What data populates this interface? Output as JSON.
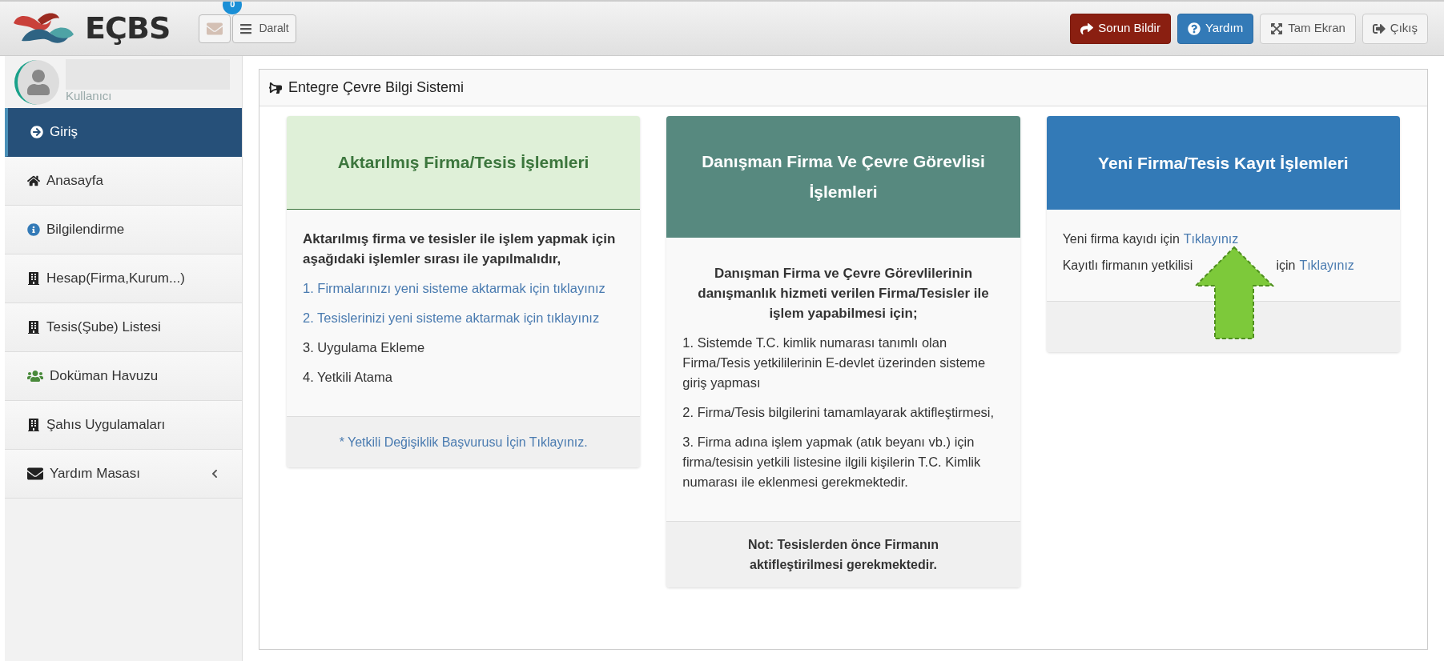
{
  "header": {
    "logo": "EÇBS",
    "mail_badge": "0",
    "collapse_button": "Daralt",
    "buttons": [
      {
        "kind": "report",
        "label": "Sorun Bildir"
      },
      {
        "kind": "help",
        "label": "Yardım"
      },
      {
        "kind": "fullscreen",
        "label": "Tam Ekran"
      },
      {
        "kind": "logout",
        "label": "Çıkış"
      }
    ]
  },
  "user": {
    "role": "Kullanıcı"
  },
  "sidebar": {
    "items": [
      {
        "kind": "login",
        "label": "Giriş",
        "selected": true
      },
      {
        "kind": "home",
        "label": "Anasayfa",
        "selected": false
      },
      {
        "kind": "info",
        "label": "Bilgilendirme",
        "selected": false
      },
      {
        "kind": "building",
        "label": "Hesap(Firma,Kurum...)",
        "selected": false
      },
      {
        "kind": "building",
        "label": "Tesis(Şube) Listesi",
        "selected": false
      },
      {
        "kind": "users",
        "label": "Doküman Havuzu",
        "selected": false
      },
      {
        "kind": "building",
        "label": "Şahıs Uygulamaları",
        "selected": false
      },
      {
        "kind": "mail",
        "label": "Yardım Masası",
        "selected": false,
        "submenu": true
      }
    ]
  },
  "panel": {
    "title": "Entegre Çevre Bilgi Sistemi",
    "cards": [
      {
        "kind": "green",
        "title": "Aktarılmış Firma/Tesis İşlemleri",
        "intro": "Aktarılmış firma ve tesisler ile işlem yapmak için aşağıdaki işlemler sırası ile yapılmalıdır,",
        "lines": [
          {
            "kind": "link",
            "text": "1. Firmalarınızı yeni sisteme aktarmak için tıklayınız"
          },
          {
            "kind": "link",
            "text": "2. Tesislerinizi yeni sisteme aktarmak için tıklayınız"
          },
          {
            "kind": "plain",
            "text": "3. Uygulama Ekleme"
          },
          {
            "kind": "plain",
            "text": "4. Yetkili Atama"
          }
        ],
        "footer": {
          "kind": "link",
          "text": "* Yetkili Değişiklik Başvurusu İçin Tıklayınız."
        }
      },
      {
        "kind": "teal",
        "title": "Danışman Firma Ve Çevre Görevlisi İşlemleri",
        "intro": "Danışman Firma ve Çevre Görevlilerinin danışmanlık hizmeti verilen Firma/Tesisler ile işlem yapabilmesi için;",
        "lines": [
          {
            "kind": "plain",
            "text": "1. Sistemde T.C. kimlik numarası tanımlı olan Firma/Tesis yetkililerinin E-devlet üzerinden sisteme giriş yapması"
          },
          {
            "kind": "plain",
            "text": "2. Firma/Tesis bilgilerini tamamlayarak aktifleştirmesi,"
          },
          {
            "kind": "plain",
            "text": "3. Firma adına işlem yapmak (atık beyanı vb.) için firma/tesisin yetkili listesine ilgili kişilerin T.C. Kimlik numarası ile eklenmesi gerekmektedir."
          }
        ],
        "footer": {
          "kind": "note",
          "text": "Not: Tesislerden önce Firmanın aktifleştirilmesi gerekmektedir."
        }
      },
      {
        "kind": "blue",
        "title": "Yeni Firma/Tesis Kayıt İşlemleri",
        "lines": [
          {
            "kind": "cta",
            "text": "Yeni firma kayıdı için",
            "link": "Tıklayınız"
          },
          {
            "kind": "cta",
            "text": "Kayıtlı firmanın yetkilisi",
            "after": "için",
            "link": "Tıklayınız"
          }
        ]
      }
    ]
  }
}
